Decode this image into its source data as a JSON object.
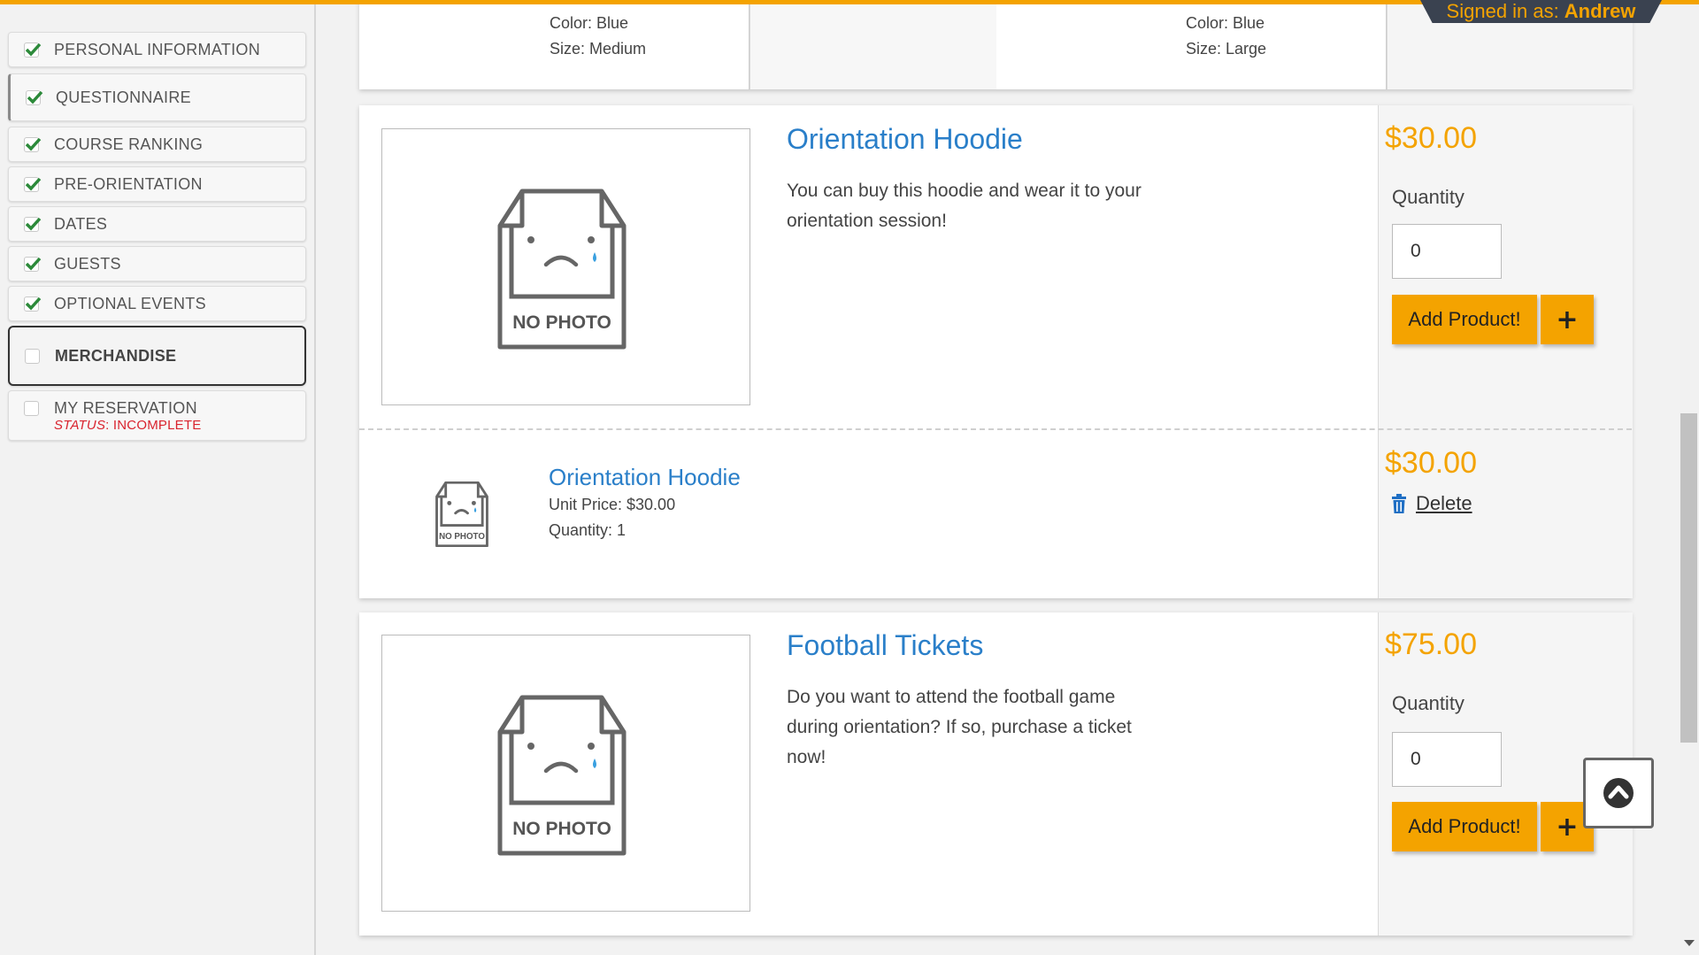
{
  "header": {
    "signed_in_prefix": "Signed in as:",
    "user_name": "Andrew"
  },
  "sidebar": {
    "items": [
      {
        "label": "PERSONAL INFORMATION",
        "checked": true
      },
      {
        "label": "QUESTIONNAIRE",
        "checked": true
      },
      {
        "label": "COURSE RANKING",
        "checked": true
      },
      {
        "label": "PRE-ORIENTATION",
        "checked": true
      },
      {
        "label": "DATES",
        "checked": true
      },
      {
        "label": "GUESTS",
        "checked": true
      },
      {
        "label": "OPTIONAL EVENTS",
        "checked": true
      },
      {
        "label": "MERCHANDISE",
        "checked": false,
        "active": true
      },
      {
        "label": "MY RESERVATION",
        "checked": false,
        "status_label": "STATUS",
        "status_value": ": INCOMPLETE"
      }
    ]
  },
  "top_card": {
    "left": {
      "color": "Color: Blue",
      "size": "Size: Medium"
    },
    "right": {
      "color": "Color: Blue",
      "size": "Size: Large"
    }
  },
  "products": [
    {
      "title": "Orientation Hoodie",
      "description": "You can buy this hoodie and wear it to your orientation session!",
      "price": "$30.00",
      "quantity_label": "Quantity",
      "quantity_value": "0",
      "add_label": "Add Product!",
      "no_photo": "NO PHOTO"
    },
    {
      "title": "Football Tickets",
      "description": "Do you want to attend the football game during orientation? If so, purchase a ticket now!",
      "price": "$75.00",
      "quantity_label": "Quantity",
      "quantity_value": "0",
      "add_label": "Add Product!",
      "no_photo": "NO PHOTO"
    }
  ],
  "cart_item": {
    "title": "Orientation Hoodie",
    "unit_price": "Unit Price: $30.00",
    "quantity": "Quantity: 1",
    "price": "$30.00",
    "delete_label": "Delete",
    "no_photo": "NO PHOTO"
  },
  "colors": {
    "accent": "#f4a300",
    "link": "#2a7fc9",
    "status": "#d9232e",
    "header_bg": "#3a4250"
  },
  "icons": {
    "check": "check-icon",
    "trash": "trash-icon",
    "plus": "plus-icon",
    "scroll_top": "chevron-up-circle-icon",
    "no_photo": "no-photo-box-icon"
  }
}
